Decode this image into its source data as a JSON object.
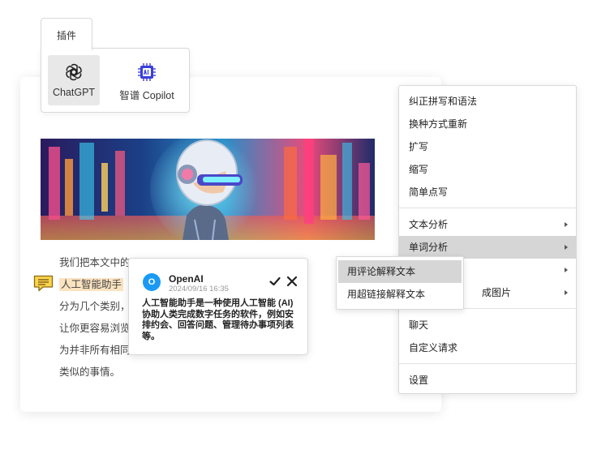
{
  "plugins": {
    "tab_label": "插件",
    "items": [
      {
        "label": "ChatGPT",
        "icon": "openai-icon",
        "selected": true
      },
      {
        "label": "智谱 Copilot",
        "icon": "ai-chip-icon",
        "selected": false
      }
    ]
  },
  "document": {
    "banner_image": "ai-robot-with-headphones-image",
    "lines": [
      "我们把本文中的",
      "人工智能助手",
      "分为几个类别，",
      "让你更容易浏览",
      "为并非所有相同",
      "类似的事情。"
    ],
    "highlight_color": "#fbe3c0"
  },
  "comment": {
    "avatar_letter": "O",
    "author": "OpenAI",
    "timestamp": "2024/09/16  16:35",
    "body": "人工智能助手是一种使用人工智能 (AI) 协助人类完成数字任务的软件，例如安排约会、回答问题、管理待办事项列表等。",
    "avatar_color": "#1a9af5"
  },
  "context_menu": {
    "groups": [
      [
        "纠正拼写和语法",
        "换种方式重新",
        "扩写",
        "缩写",
        "简单点写"
      ],
      [
        "文本分析",
        "单词分析",
        "",
        "成图片"
      ],
      [
        "聊天",
        "自定义请求"
      ],
      [
        "设置"
      ]
    ],
    "active_item": "单词分析"
  },
  "submenu": {
    "items": [
      "用评论解释文本",
      "用超链接解释文本"
    ],
    "active_item": "用评论解释文本"
  },
  "colors": {
    "menu_active": "#d6d6d6",
    "border": "#d9d9d9"
  }
}
